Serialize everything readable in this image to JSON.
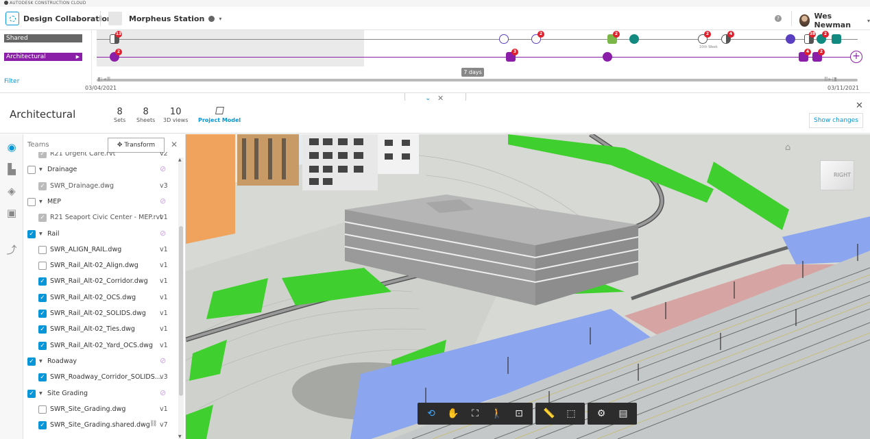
{
  "brand": {
    "name": "AUTODESK CONSTRUCTION CLOUD"
  },
  "nav": {
    "app_name": "Design Collaboration",
    "project_name": "Morpheus Station",
    "user_name": "Wes Newman",
    "help_glyph": "?",
    "caret_glyph": "▾",
    "icons": {
      "app": "design-collaboration-icon",
      "globe": "globe-icon",
      "help": "help-icon"
    }
  },
  "timeline": {
    "shared_label": "Shared",
    "architectural_label": "Architectural",
    "filter_label": "Filter",
    "play_glyph": "▶",
    "range_label": "7 days",
    "week_label": "10th Week",
    "start_date": "03/04/2021",
    "end_date": "03/11/2021",
    "back_controls": "◧◂Ⅲ",
    "fwd_controls": "Ⅲ▸◨",
    "add_glyph": "+",
    "badges": {
      "shared_first": "13",
      "shared_2": "2",
      "shared_3": "2",
      "shared_4": "2",
      "shared_5": "4",
      "shared_6": "38",
      "shared_7": "2",
      "arch_first": "2",
      "arch_2": "3",
      "arch_3": "4",
      "arch_4": "2"
    },
    "colors": {
      "shared": "#666666",
      "architectural": "#8a1ea8",
      "teal": "#138a7f",
      "green": "#7ab648",
      "violet": "#5a3fc0"
    }
  },
  "collapse": {
    "chevron": "⌄",
    "close": "✕"
  },
  "header": {
    "title": "Architectural",
    "sets_value": "8",
    "sets_label": "Sets",
    "sheets_value": "8",
    "sheets_label": "Sheets",
    "views_value": "10",
    "views_label": "3D views",
    "project_model_label": "Project Model",
    "close_glyph": "✕",
    "show_changes_label": "Show changes"
  },
  "rail": {
    "icons": [
      "eye-icon",
      "sheets-icon",
      "layers-icon",
      "properties-icon",
      "compare-icon"
    ]
  },
  "panel": {
    "teams_label": "Teams",
    "transform_label": "Transform",
    "transform_glyph": "✥",
    "close_glyph": "✕",
    "rows": [
      {
        "kind": "file",
        "name": "R21 Urgent Care.rvt",
        "version": "v2",
        "state": "dis"
      },
      {
        "kind": "group",
        "name": "Drainage",
        "state": "off"
      },
      {
        "kind": "file",
        "name": "SWR_Drainage.dwg",
        "version": "v3",
        "state": "dis"
      },
      {
        "kind": "group",
        "name": "MEP",
        "state": "off"
      },
      {
        "kind": "file",
        "name": "R21 Seaport Civic Center - MEP.rvt",
        "version": "v1",
        "state": "dis"
      },
      {
        "kind": "group",
        "name": "Rail",
        "state": "on"
      },
      {
        "kind": "file",
        "name": "SWR_ALIGN_RAIL.dwg",
        "version": "v1",
        "state": "off"
      },
      {
        "kind": "file",
        "name": "SWR_Rail_Alt-02_Align.dwg",
        "version": "v1",
        "state": "off"
      },
      {
        "kind": "file",
        "name": "SWR_Rail_Alt-02_Corridor.dwg",
        "version": "v1",
        "state": "on"
      },
      {
        "kind": "file",
        "name": "SWR_Rail_Alt-02_OCS.dwg",
        "version": "v1",
        "state": "on"
      },
      {
        "kind": "file",
        "name": "SWR_Rail_Alt-02_SOLIDS.dwg",
        "version": "v1",
        "state": "on"
      },
      {
        "kind": "file",
        "name": "SWR_Rail_Alt-02_Ties.dwg",
        "version": "v1",
        "state": "on"
      },
      {
        "kind": "file",
        "name": "SWR_Rail_Alt-02_Yard_OCS.dwg",
        "version": "v1",
        "state": "on"
      },
      {
        "kind": "group",
        "name": "Roadway",
        "state": "on"
      },
      {
        "kind": "file",
        "name": "SWR_Roadway_Corridor_SOLIDS....",
        "version": "v3",
        "state": "on"
      },
      {
        "kind": "group",
        "name": "Site Grading",
        "state": "on"
      },
      {
        "kind": "file",
        "name": "SWR_Site_Grading.dwg",
        "version": "v1",
        "state": "off"
      },
      {
        "kind": "file",
        "name": "SWR_Site_Grading.shared.dwg",
        "version": "v7",
        "state": "on",
        "linked": true
      }
    ],
    "check_glyph": "✓",
    "expand_glyph": "▾",
    "visibility_glyph": "⊘",
    "link_glyph": "⛓"
  },
  "viewer": {
    "home_glyph": "⌂",
    "viewcube_label": "RIGHT",
    "toolbar": [
      [
        "orbit-icon",
        "pan-icon",
        "fit-view-icon",
        "first-person-icon",
        "section-box-icon"
      ],
      [
        "measure-icon",
        "explode-model-icon"
      ],
      [
        "settings-icon",
        "properties-panel-icon"
      ]
    ],
    "toolbar_glyphs": [
      [
        "⟲",
        "✋",
        "⛶",
        "🚶",
        "⊡"
      ],
      [
        "📏",
        "⬚"
      ],
      [
        "⚙",
        "▤"
      ]
    ]
  }
}
